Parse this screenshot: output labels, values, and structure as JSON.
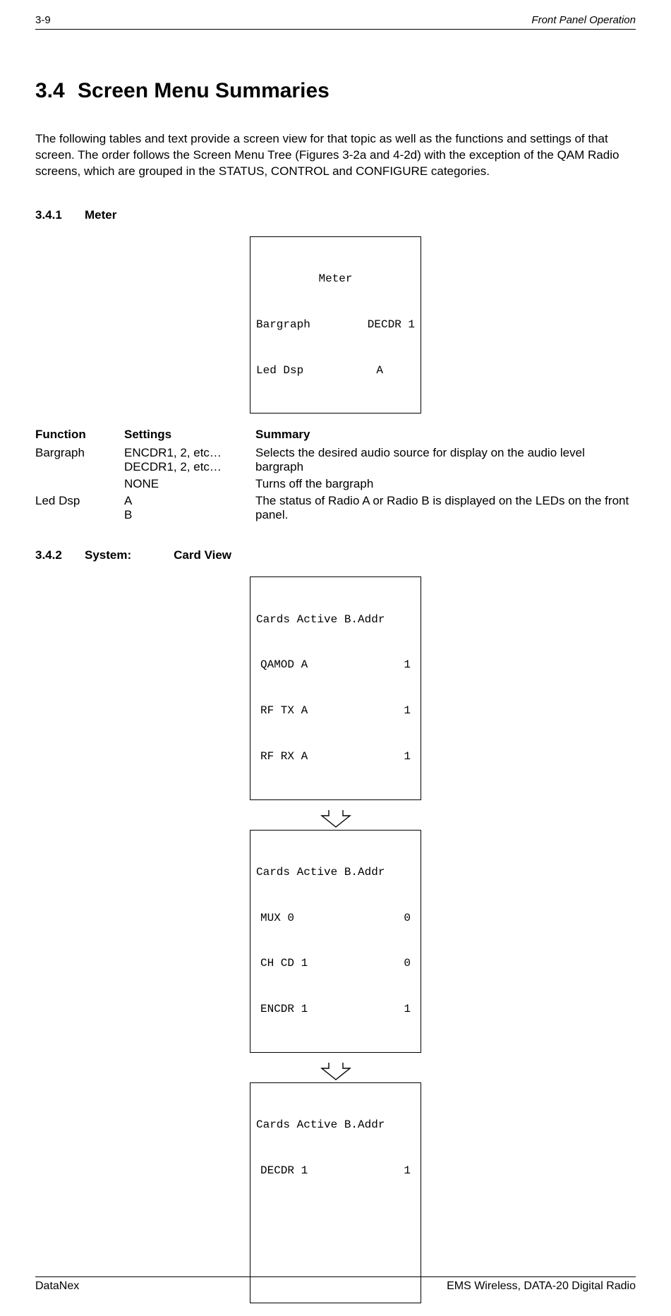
{
  "header": {
    "page_num": "3-9",
    "section": "Front Panel Operation"
  },
  "title": {
    "num": "3.4",
    "text": "Screen Menu Summaries"
  },
  "intro": "The following tables and text provide a screen view for that topic as well as the functions and settings of that screen.  The order follows the Screen Menu Tree (Figures 3-2a and 4-2d) with the exception of the QAM Radio screens, which are grouped in the STATUS, CONTROL and CONFIGURE categories.",
  "s341": {
    "num": "3.4.1",
    "label": "Meter",
    "screen": {
      "title": "Meter",
      "line1_left": "Bargraph",
      "line1_right": "DECDR 1",
      "line2_left": "Led Dsp",
      "line2_right": "A"
    },
    "table": {
      "h1": "Function",
      "h2": "Settings",
      "h3": "Summary",
      "rows": [
        {
          "func": "Bargraph",
          "settings": "ENCDR1, 2, etc…\nDECDR1, 2, etc…",
          "summary": "Selects the desired audio source for display on the audio level bargraph"
        },
        {
          "func": "",
          "settings": "NONE",
          "summary": "Turns off the bargraph"
        },
        {
          "func": "Led Dsp",
          "settings": "A\nB",
          "summary": "The status of Radio A or Radio B is displayed on the LEDs on the front panel."
        }
      ]
    }
  },
  "s342": {
    "num": "3.4.2",
    "label1": "System:",
    "label2": "Card View",
    "screens": [
      {
        "header": "Cards Active B.Addr",
        "rows": [
          {
            "l": "QAMOD A",
            "r": "1"
          },
          {
            "l": "RF TX A",
            "r": "1"
          },
          {
            "l": "RF RX A",
            "r": "1"
          }
        ]
      },
      {
        "header": "Cards Active B.Addr",
        "rows": [
          {
            "l": "MUX 0",
            "r": "0"
          },
          {
            "l": "CH CD 1",
            "r": "0"
          },
          {
            "l": "ENCDR 1",
            "r": "1"
          }
        ]
      },
      {
        "header": "Cards Active B.Addr",
        "rows": [
          {
            "l": "DECDR 1",
            "r": "1"
          },
          {
            "l": "",
            "r": ""
          },
          {
            "l": "",
            "r": ""
          }
        ]
      }
    ]
  },
  "footer": {
    "left": "DataNex",
    "right": "EMS Wireless, DATA-20 Digital Radio"
  }
}
